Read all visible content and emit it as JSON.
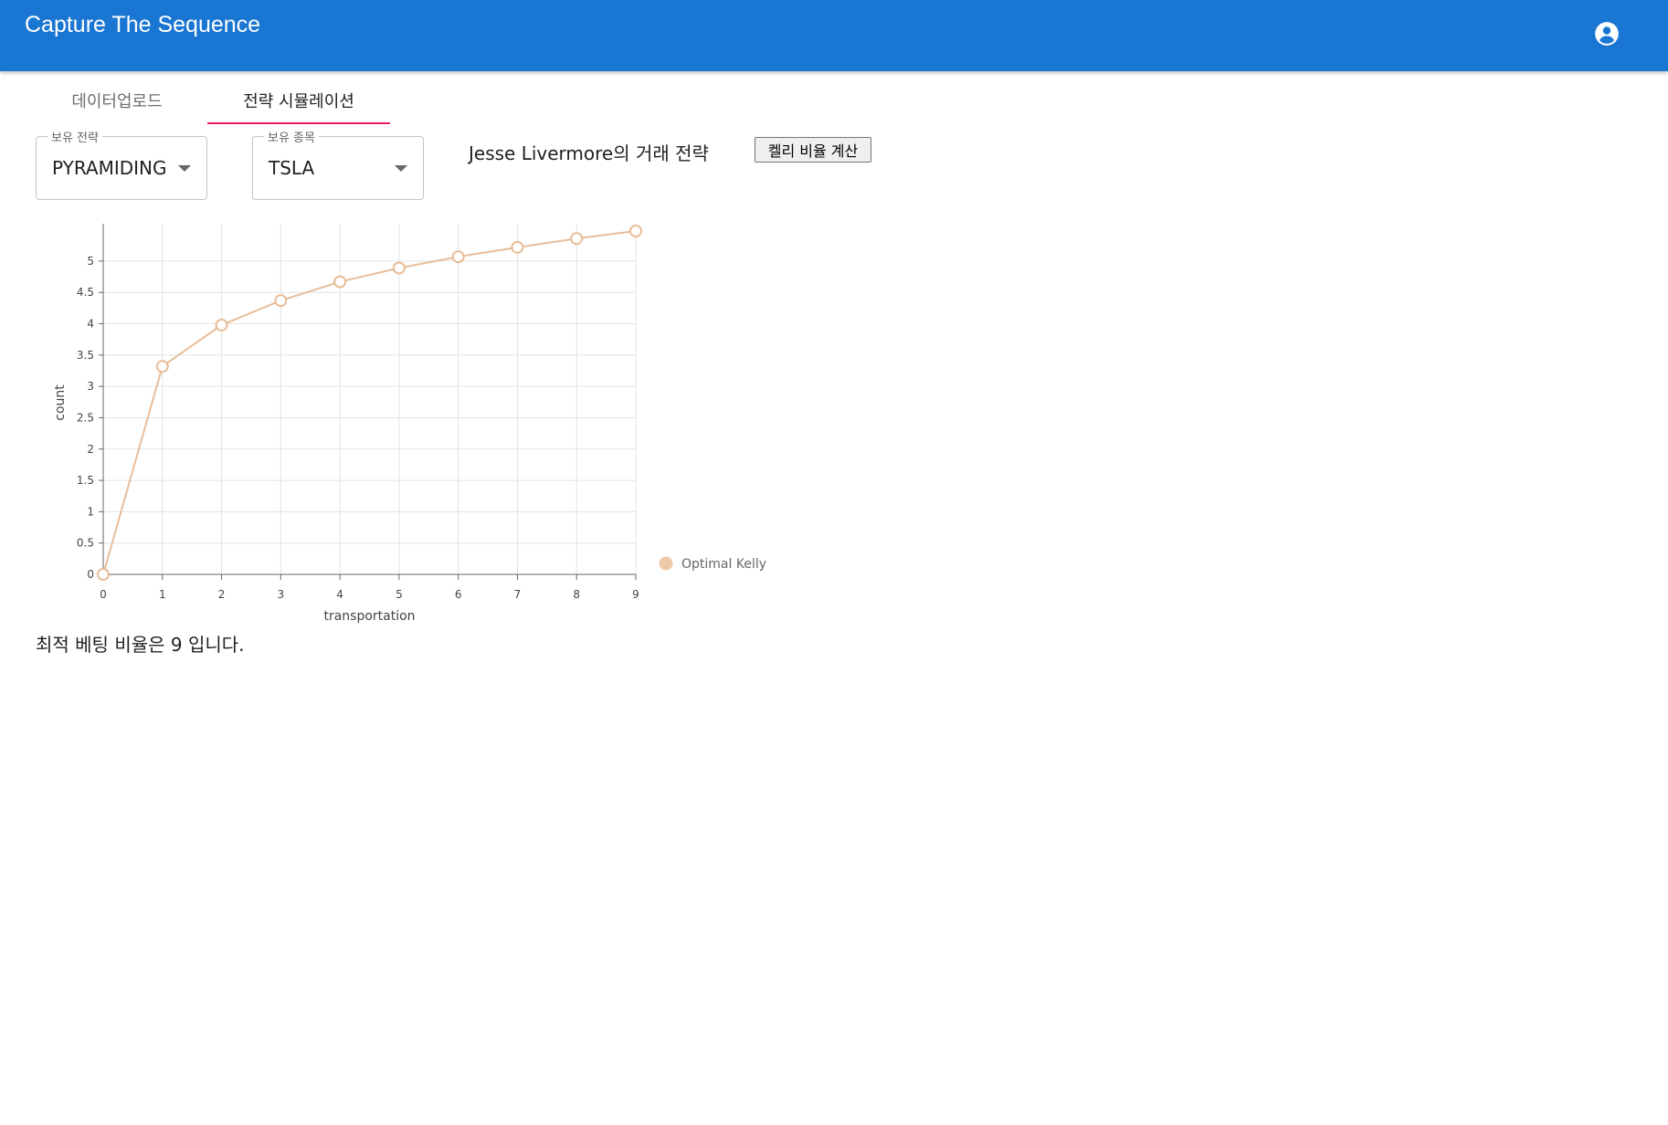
{
  "app": {
    "title": "Capture The Sequence"
  },
  "icons": {
    "account": "account-circle-icon",
    "caret": "caret-down-icon"
  },
  "colors": {
    "appbar": "#1976d2",
    "tab_indicator": "#e91e63",
    "series": "#e8bd98",
    "legend_dot": "#edc9aa"
  },
  "tabs": [
    {
      "label": "데이터업로드",
      "selected": false
    },
    {
      "label": "전략 시뮬레이션",
      "selected": true
    }
  ],
  "controls": {
    "strategy": {
      "label": "보유 전략",
      "value": "PYRAMIDING"
    },
    "stock": {
      "label": "보유 종목",
      "value": "TSLA"
    },
    "strategy_title": "Jesse Livermore의 거래 전략",
    "kelly_button": "켈리 비율 계산"
  },
  "chart_data": {
    "type": "line",
    "x": [
      0,
      1,
      2,
      3,
      4,
      5,
      6,
      7,
      8,
      9
    ],
    "series": [
      {
        "name": "Optimal Kelly",
        "values": [
          0,
          3.32,
          3.98,
          4.37,
          4.67,
          4.89,
          5.07,
          5.22,
          5.36,
          5.48
        ]
      }
    ],
    "xlabel": "transportation",
    "ylabel": "count",
    "xticks": [
      "0",
      "1",
      "2",
      "3",
      "4",
      "5",
      "6",
      "7",
      "8",
      "9"
    ],
    "yticks": [
      "0",
      "0.5",
      "1",
      "1.5",
      "2",
      "2.5",
      "3",
      "3.5",
      "4",
      "4.5",
      "5"
    ],
    "xlim": [
      0,
      9
    ],
    "ylim": [
      0,
      5.48
    ],
    "grid": true,
    "legend_position": "right"
  },
  "result": {
    "text": "최적 베팅 비율은 9 입니다."
  }
}
